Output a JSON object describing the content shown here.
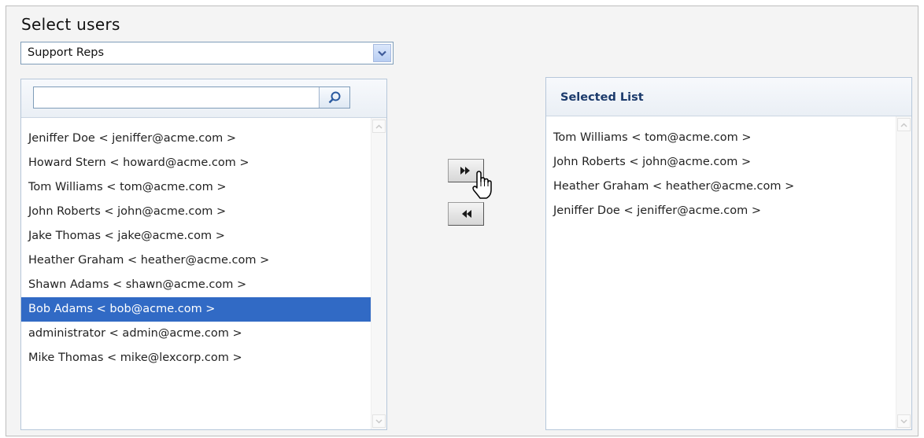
{
  "header": {
    "title": "Select users"
  },
  "group_select": {
    "value": "Support Reps",
    "arrow_icon": "chevron-down-icon"
  },
  "search": {
    "value": "",
    "placeholder": "",
    "icon": "search-icon"
  },
  "available_list": {
    "selected_index": 7,
    "items": [
      "Jeniffer Doe < jeniffer@acme.com >",
      "Howard Stern < howard@acme.com >",
      "Tom Williams < tom@acme.com >",
      "John Roberts < john@acme.com >",
      "Jake Thomas < jake@acme.com >",
      "Heather Graham < heather@acme.com >",
      "Shawn Adams < shawn@acme.com >",
      "Bob Adams < bob@acme.com >",
      "administrator < admin@acme.com >",
      "Mike Thomas < mike@lexcorp.com >"
    ]
  },
  "controls": {
    "add_icon": "double-chevron-right-icon",
    "remove_icon": "double-chevron-left-icon",
    "cursor_icon": "hand-pointer-icon"
  },
  "selected_list": {
    "title": "Selected List",
    "items": [
      "Tom Williams < tom@acme.com >",
      "John Roberts < john@acme.com >",
      "Heather Graham < heather@acme.com >",
      "Jeniffer Doe < jeniffer@acme.com >"
    ]
  },
  "colors": {
    "selection_bg": "#316ac5",
    "selected_title": "#1b3a6b",
    "panel_border": "#b6c7da"
  }
}
